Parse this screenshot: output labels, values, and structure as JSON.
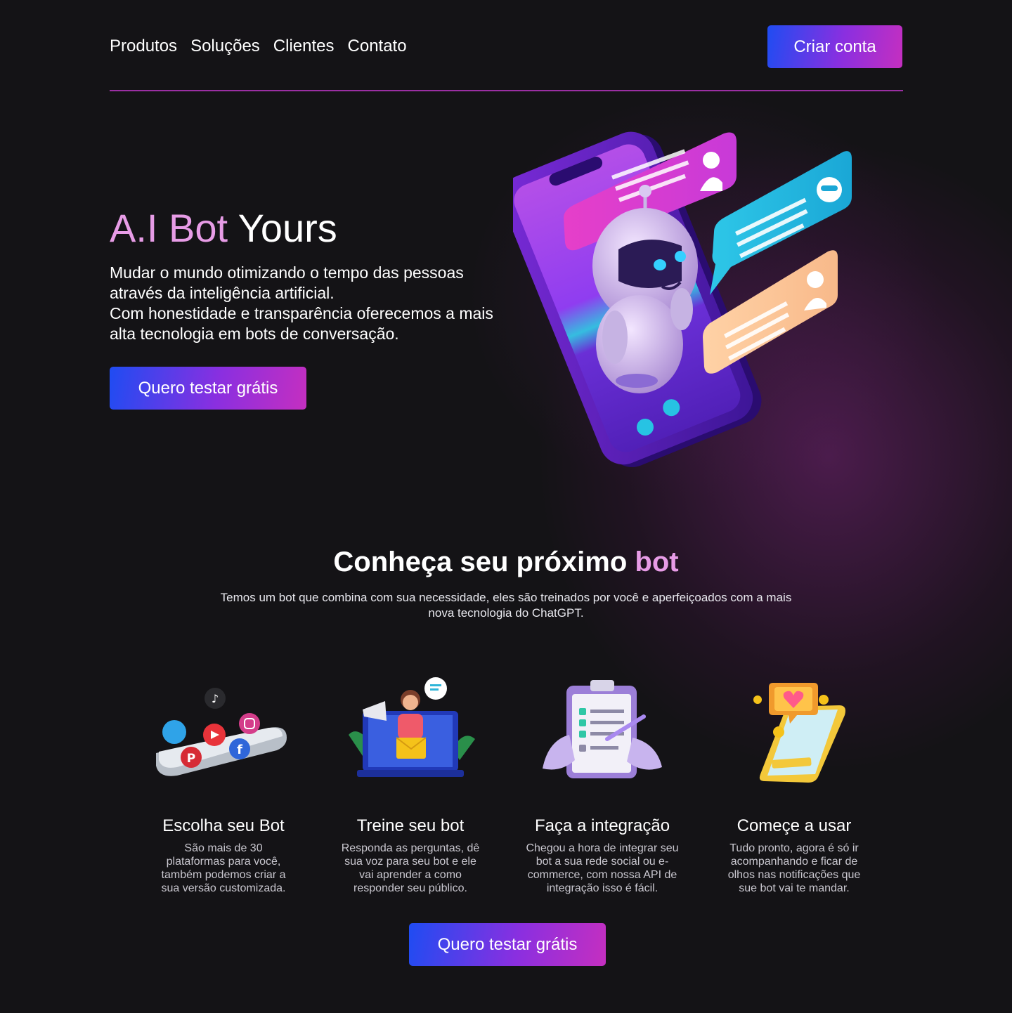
{
  "nav": {
    "items": [
      "Produtos",
      "Soluções",
      "Clientes",
      "Contato"
    ],
    "cta_label": "Criar conta"
  },
  "hero": {
    "title_accent": "A.I Bot",
    "title_rest": " Yours",
    "description_line1": "Mudar o mundo otimizando o tempo das pessoas através da inteligência artificial.",
    "description_line2": "Com honestidade e transparência oferecemos a mais alta tecnologia em bots de conversação.",
    "cta_label": "Quero testar grátis"
  },
  "section": {
    "title_main": "Conheça seu próximo ",
    "title_accent": "bot",
    "subtitle": "Temos um bot que combina com sua necessidade, eles são treinados por você e aperfeiçoados com a mais nova tecnologia do ChatGPT.",
    "cta_label": "Quero testar grátis"
  },
  "steps": [
    {
      "title": "Escolha seu Bot",
      "text": "São mais de 30 plataformas para você, também podemos criar a sua versão customizada."
    },
    {
      "title": "Treine seu bot",
      "text": "Responda as perguntas, dê sua voz para seu bot e ele vai aprender a como responder seu público."
    },
    {
      "title": "Faça a integração",
      "text": "Chegou a hora de integrar seu bot a sua rede social ou e-commerce, com nossa API de integração isso é fácil."
    },
    {
      "title": "Começe a usar",
      "text": "Tudo pronto, agora é só ir acompanhando e ficar de olhos nas notificações que sue bot vai te mandar."
    }
  ],
  "colors": {
    "accent_pink": "#e79ce6",
    "button_gradient_start": "#1f4cf2",
    "button_gradient_end": "#c52fc0",
    "background": "#141316"
  },
  "icons": [
    "robot-phone-illustration",
    "social-phone-illustration",
    "laptop-marketing-illustration",
    "clipboard-checklist-illustration",
    "phone-notification-illustration"
  ]
}
